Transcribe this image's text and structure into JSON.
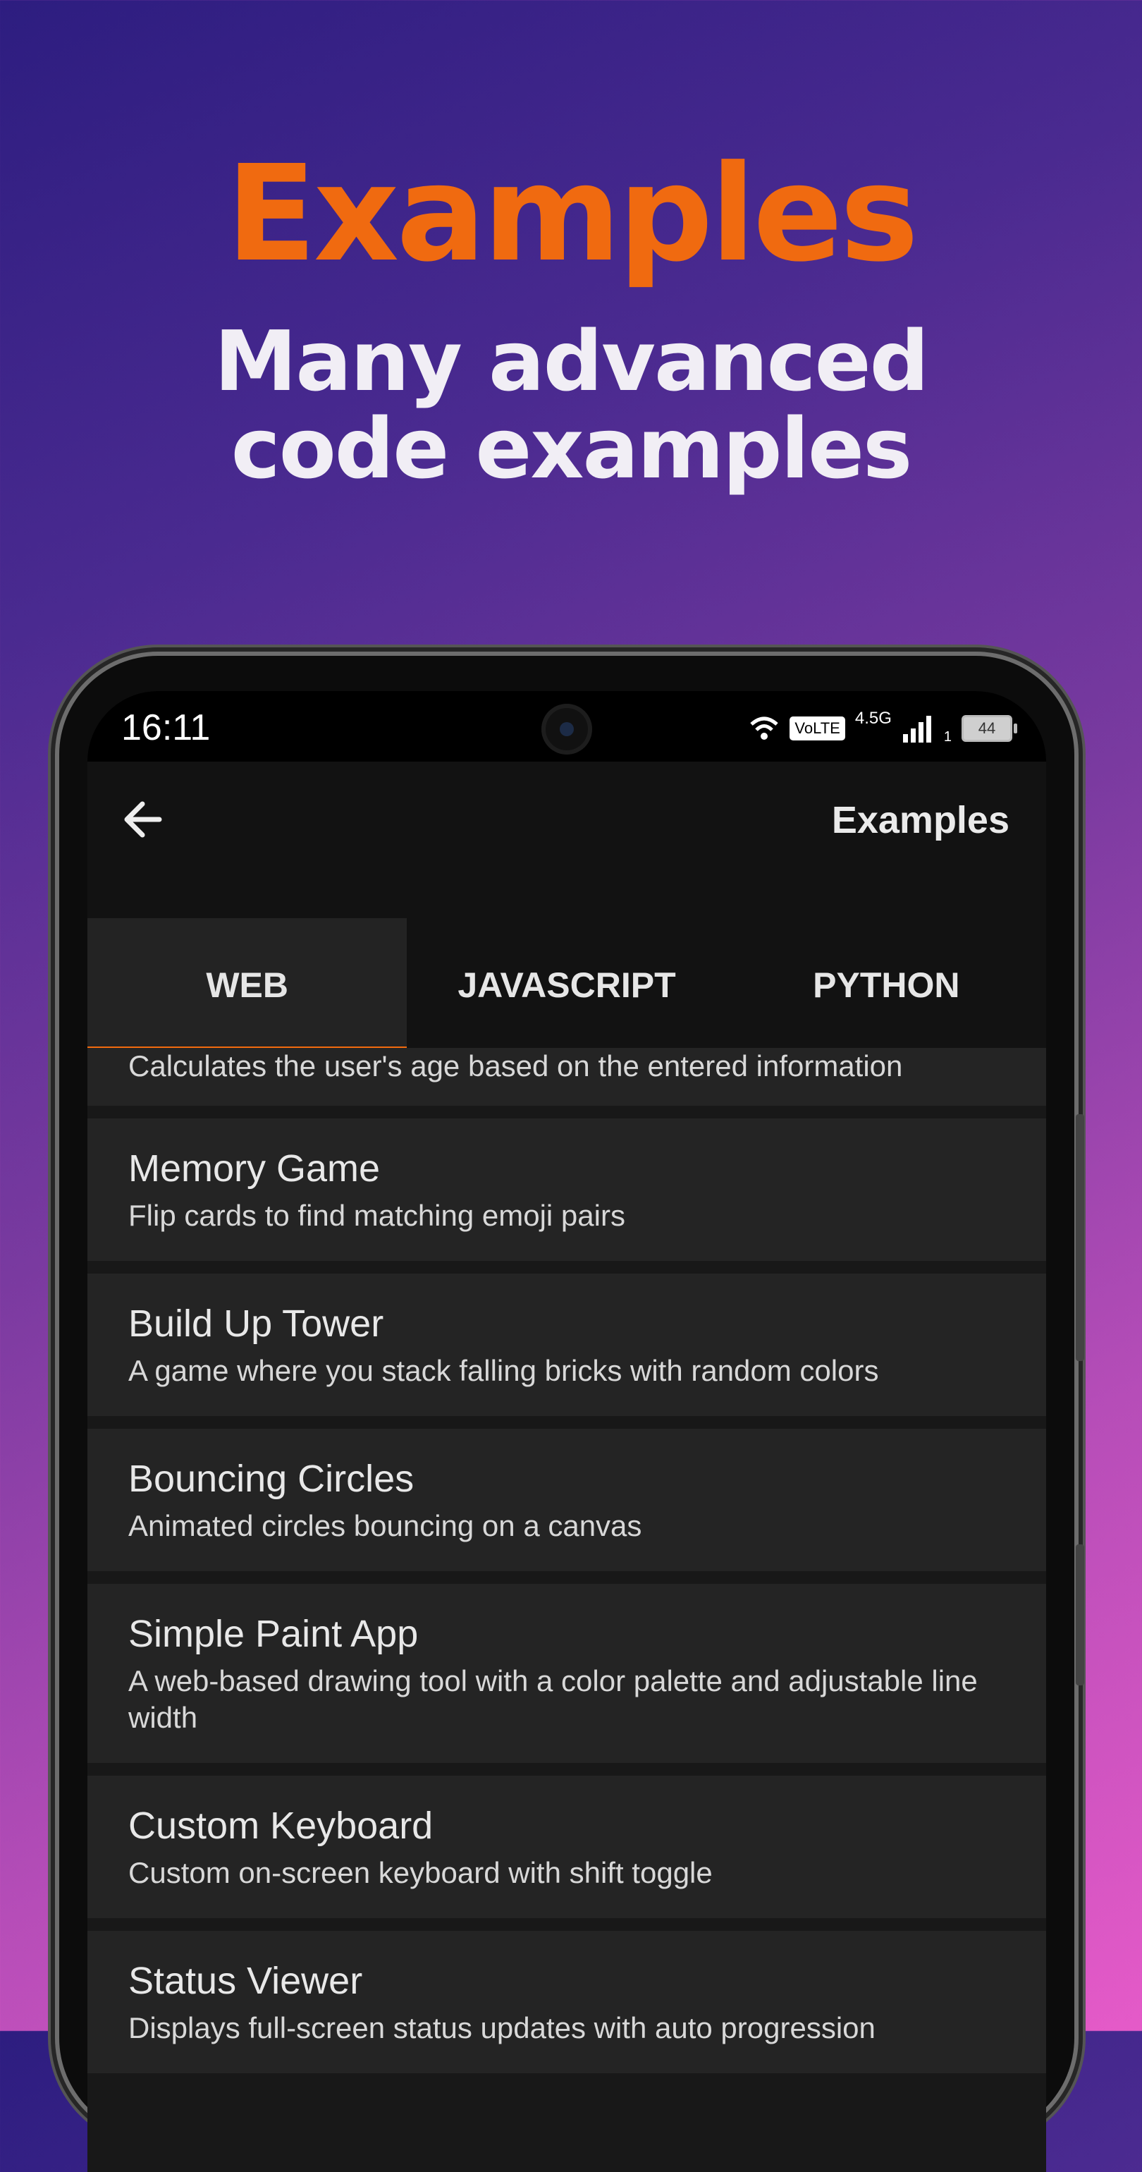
{
  "colors": {
    "accent": "#f26a0e",
    "headline": "#f06a10",
    "subhead": "#f1eef5"
  },
  "hero": {
    "title": "Examples",
    "subtitle_line1": "Many advanced",
    "subtitle_line2": "code examples"
  },
  "status_bar": {
    "time": "16:11",
    "volte": "VoLTE",
    "network": "4.5G",
    "sim": "1",
    "battery": "44",
    "icons": [
      "wifi-icon",
      "signal-icon",
      "battery-icon"
    ]
  },
  "app_bar": {
    "back_icon": "arrow-left-icon",
    "title": "Examples"
  },
  "tabs": [
    {
      "label": "WEB",
      "active": true
    },
    {
      "label": "JAVASCRIPT",
      "active": false
    },
    {
      "label": "PYTHON",
      "active": false
    }
  ],
  "list": {
    "partial_desc": "Calculates the user's age based on the entered information",
    "items": [
      {
        "title": "Memory Game",
        "desc": "Flip cards to find matching emoji pairs"
      },
      {
        "title": "Build Up Tower",
        "desc": "A game where you stack falling bricks with random colors"
      },
      {
        "title": "Bouncing Circles",
        "desc": "Animated circles bouncing on a canvas"
      },
      {
        "title": "Simple Paint App",
        "desc": "A web-based drawing tool with a color palette and adjustable line width"
      },
      {
        "title": "Custom Keyboard",
        "desc": "Custom on-screen keyboard with shift toggle"
      },
      {
        "title": "Status Viewer",
        "desc": "Displays full-screen status updates with auto progression"
      }
    ]
  }
}
